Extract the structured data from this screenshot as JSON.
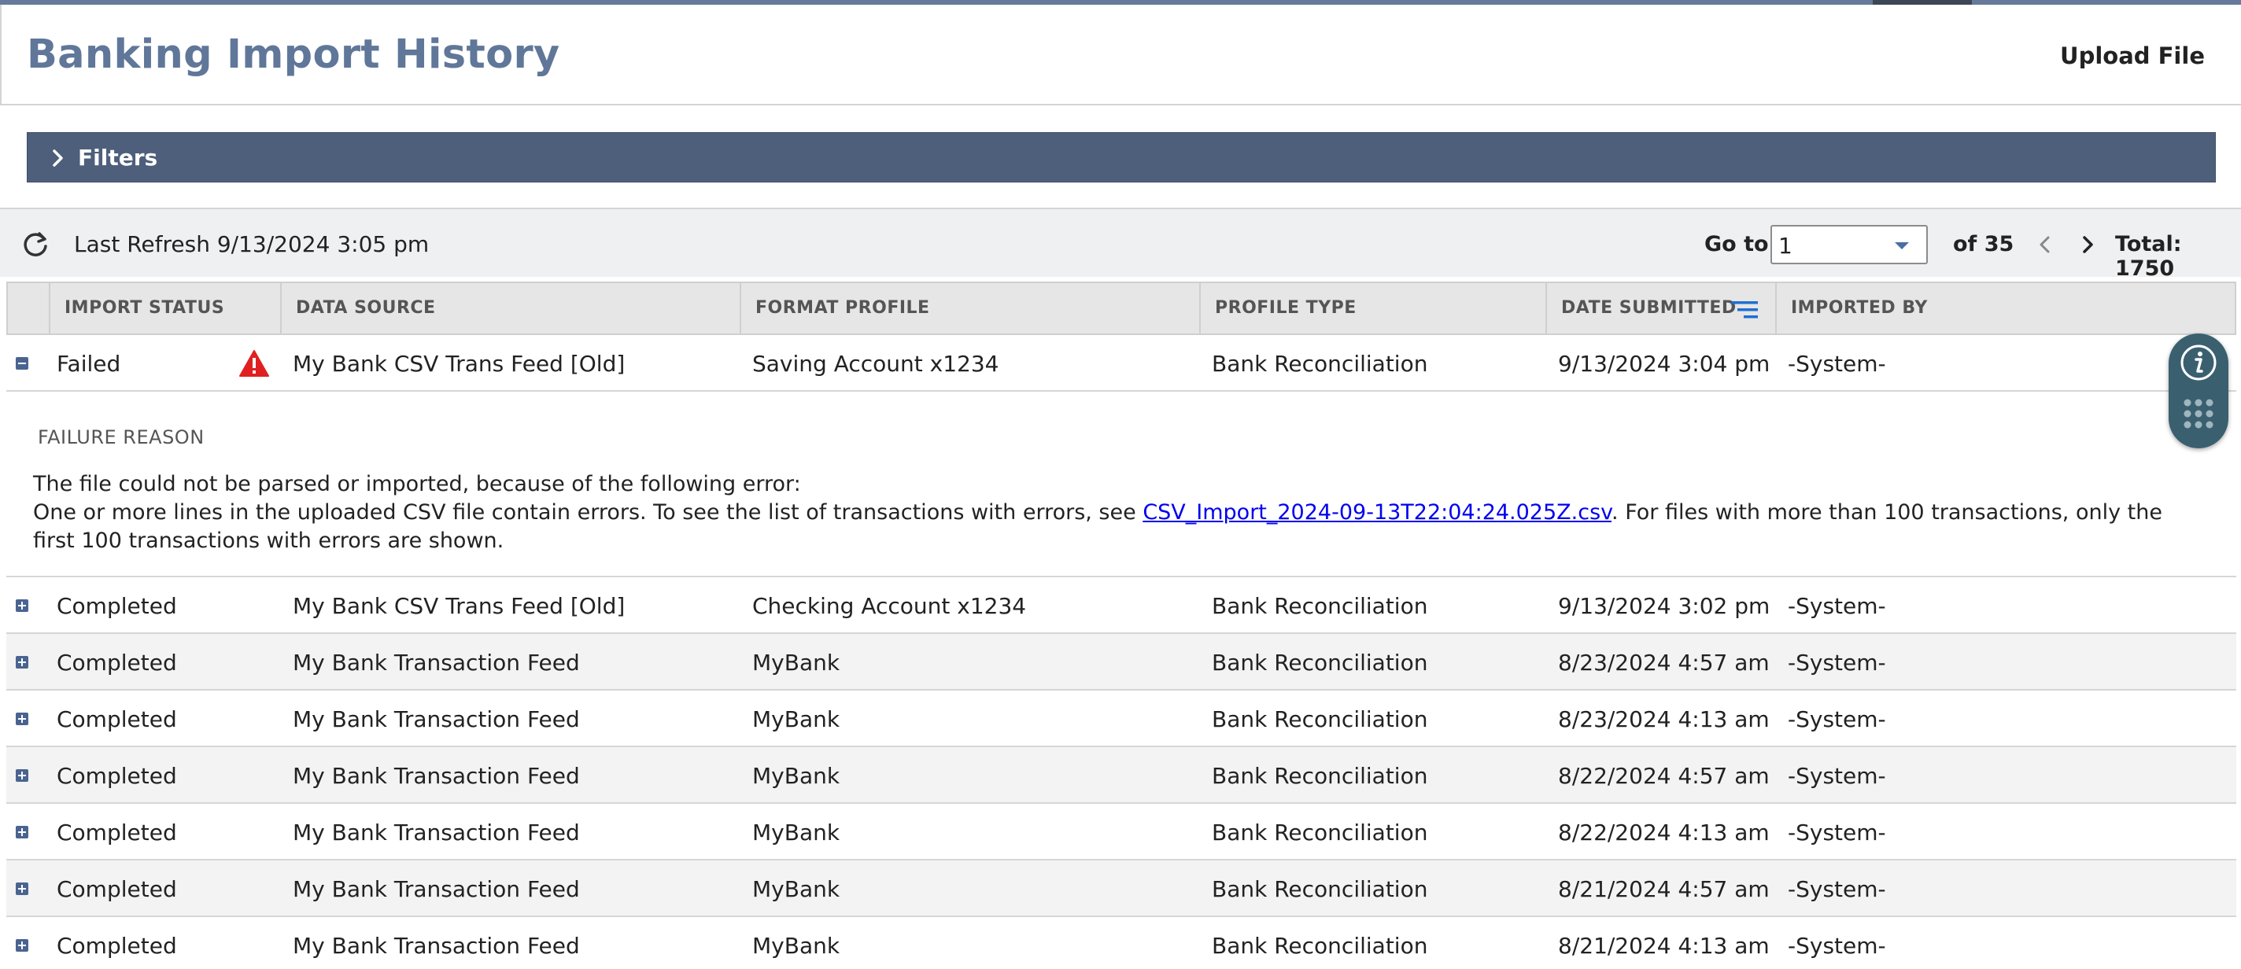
{
  "header": {
    "title": "Banking Import History",
    "upload_label": "Upload File"
  },
  "filters": {
    "label": "Filters"
  },
  "toolbar": {
    "last_refresh": "Last Refresh 9/13/2024 3:05 pm",
    "goto_label": "Go to:",
    "goto_value": "1",
    "of_pages": "of 35",
    "total": "Total: 1750"
  },
  "columns": [
    "IMPORT STATUS",
    "DATA SOURCE",
    "FORMAT PROFILE",
    "PROFILE TYPE",
    "DATE SUBMITTED",
    "IMPORTED BY"
  ],
  "rows": [
    {
      "status": "Failed",
      "source": "My Bank CSV Trans Feed [Old]",
      "format": "Saving Account x1234",
      "type": "Bank Reconciliation",
      "date": "9/13/2024 3:04 pm",
      "by": "-System-"
    },
    {
      "status": "Completed",
      "source": "My Bank CSV Trans Feed [Old]",
      "format": "Checking Account x1234",
      "type": "Bank Reconciliation",
      "date": "9/13/2024 3:02 pm",
      "by": "-System-"
    },
    {
      "status": "Completed",
      "source": "My Bank Transaction Feed",
      "format": "MyBank",
      "type": "Bank Reconciliation",
      "date": "8/23/2024 4:57 am",
      "by": "-System-"
    },
    {
      "status": "Completed",
      "source": "My Bank Transaction Feed",
      "format": "MyBank",
      "type": "Bank Reconciliation",
      "date": "8/23/2024 4:13 am",
      "by": "-System-"
    },
    {
      "status": "Completed",
      "source": "My Bank Transaction Feed",
      "format": "MyBank",
      "type": "Bank Reconciliation",
      "date": "8/22/2024 4:57 am",
      "by": "-System-"
    },
    {
      "status": "Completed",
      "source": "My Bank Transaction Feed",
      "format": "MyBank",
      "type": "Bank Reconciliation",
      "date": "8/22/2024 4:13 am",
      "by": "-System-"
    },
    {
      "status": "Completed",
      "source": "My Bank Transaction Feed",
      "format": "MyBank",
      "type": "Bank Reconciliation",
      "date": "8/21/2024 4:57 am",
      "by": "-System-"
    },
    {
      "status": "Completed",
      "source": "My Bank Transaction Feed",
      "format": "MyBank",
      "type": "Bank Reconciliation",
      "date": "8/21/2024 4:13 am",
      "by": "-System-"
    }
  ],
  "failure": {
    "label": "FAILURE REASON",
    "line1": "The file could not be parsed or imported, because of the following error:",
    "line2_pre": "One or more lines in the uploaded CSV file contain errors. To see the list of transactions with errors, see ",
    "link": "CSV_Import_2024-09-13T22:04:24.025Z.csv",
    "line2_post": ". For files with more than 100 transactions, only the first 100 transactions with errors are shown."
  },
  "colors": {
    "header_bar": "#4d5f7b",
    "title": "#607799",
    "error": "#e02020",
    "link": "#0000ee"
  },
  "icons": [
    "refresh-icon",
    "chevron-right-icon",
    "chevron-left-icon",
    "sort-filter-icon",
    "warning-icon",
    "info-icon",
    "grid-dots-icon",
    "expand-icon",
    "collapse-icon"
  ]
}
